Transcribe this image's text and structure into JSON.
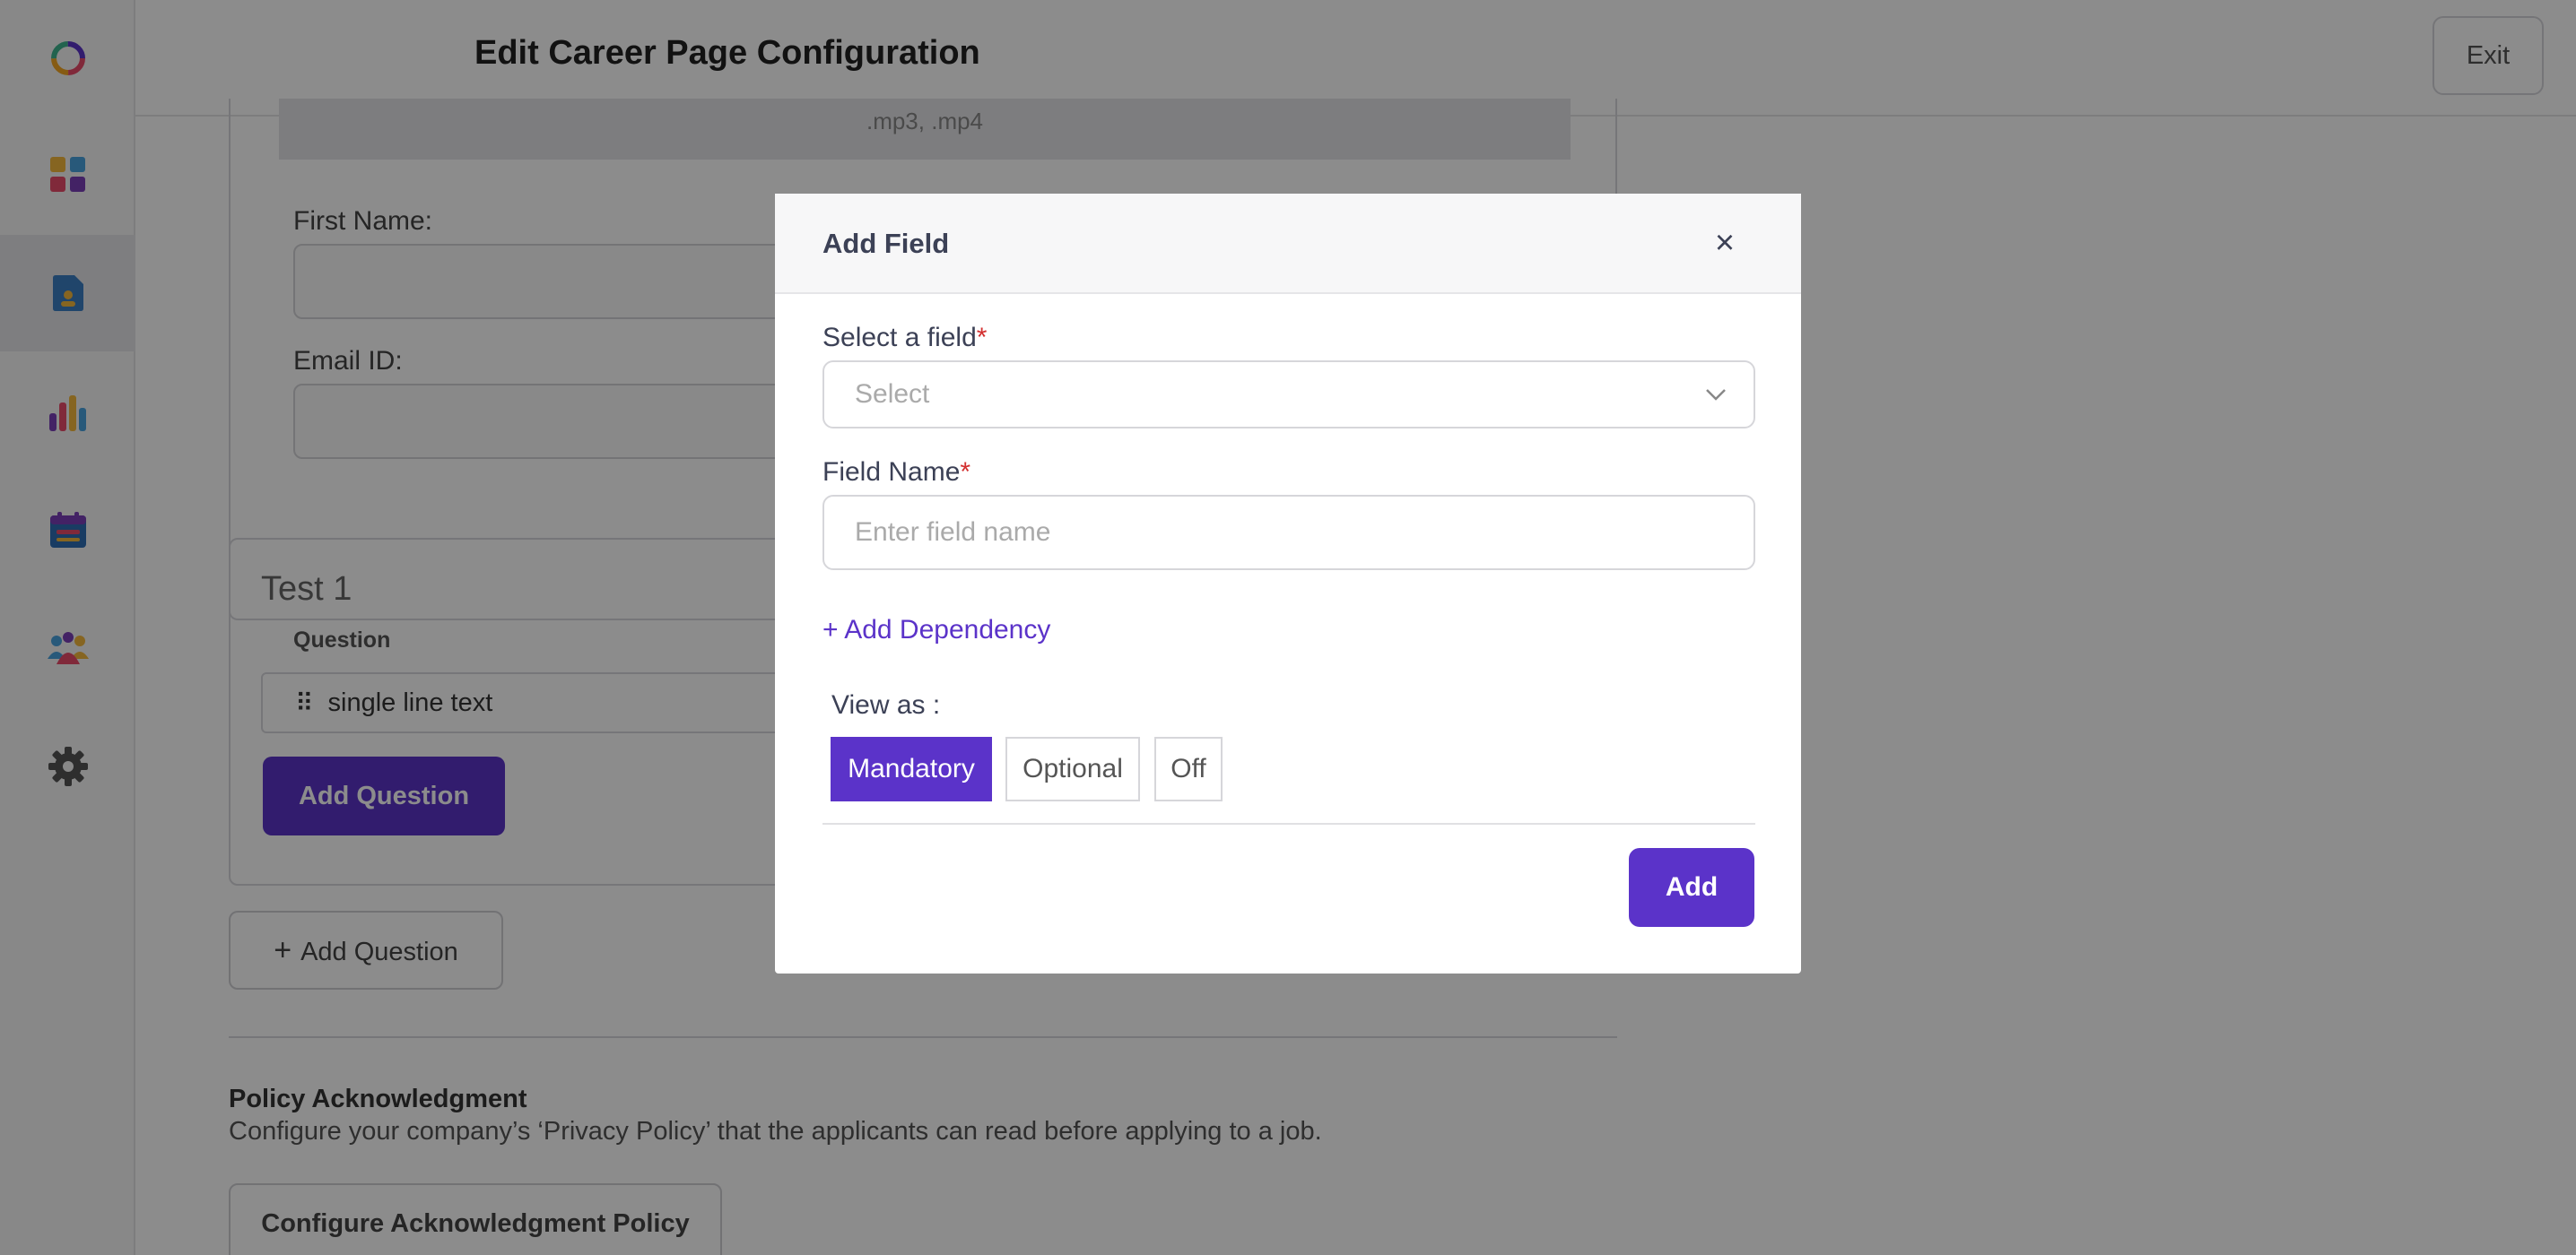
{
  "header": {
    "title": "Edit Career Page Configuration",
    "exit_label": "Exit"
  },
  "sidebar": {
    "items": [
      {
        "name": "logo",
        "icon": "ring-logo-icon"
      },
      {
        "name": "dashboard",
        "icon": "dashboard-grid-icon"
      },
      {
        "name": "documents",
        "icon": "document-person-icon",
        "active": true
      },
      {
        "name": "analytics",
        "icon": "bar-chart-icon"
      },
      {
        "name": "calendar",
        "icon": "calendar-icon"
      },
      {
        "name": "team",
        "icon": "people-icon"
      },
      {
        "name": "settings",
        "icon": "gear-icon"
      }
    ]
  },
  "background": {
    "upload_hint": ".mp3, .mp4",
    "first_name_label": "First Name:",
    "email_label": "Email ID:",
    "test_title": "Test 1",
    "question_label": "Question",
    "question_value": "single line text",
    "add_question_label": "Add Question",
    "add_question_outline_label": "Add Question",
    "policy_title": "Policy Acknowledgment",
    "policy_desc": "Configure your company’s ‘Privacy Policy’ that the applicants can read before applying to a job.",
    "config_policy_label": "Configure Acknowledgment Policy"
  },
  "modal": {
    "title": "Add Field",
    "close_glyph": "×",
    "select_label": "Select a field",
    "select_placeholder": "Select",
    "field_name_label": "Field Name",
    "field_name_placeholder": "Enter field name",
    "add_dependency_label": "+ Add Dependency",
    "view_as_label": "View as :",
    "view_options": [
      "Mandatory",
      "Optional",
      "Off"
    ],
    "view_selected": "Mandatory",
    "add_label": "Add",
    "required_mark": "*"
  },
  "colors": {
    "accent": "#5b33c9",
    "required": "#d32f2f",
    "overlay": "rgba(0,0,0,0.45)"
  }
}
